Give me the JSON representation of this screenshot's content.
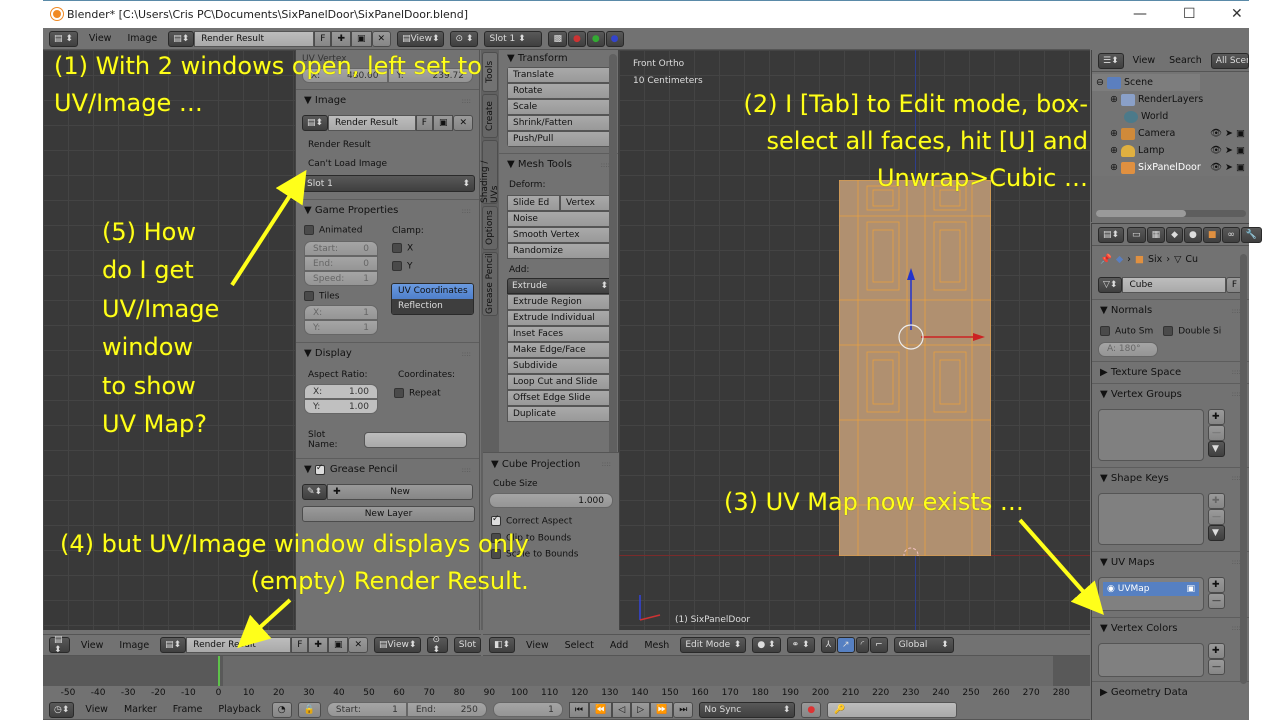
{
  "window": {
    "title": "Blender* [C:\\Users\\Cris PC\\Documents\\SixPanelDoor\\SixPanelDoor.blend]",
    "controls": {
      "minimize": "—",
      "maximize": "☐",
      "close": "✕"
    }
  },
  "image_editor_top_header": {
    "menus": [
      "View",
      "Image"
    ],
    "image_name": "Render Result",
    "fake_user": "F",
    "view_label": "View",
    "slot": "Slot 1"
  },
  "uv_image_properties": {
    "uv_vertex_header": "UV Vertex",
    "uv_x_label": "X:",
    "uv_x": "480.00",
    "uv_y_label": "Y:",
    "uv_y": "239.72",
    "image_section": "Image",
    "image_name": "Render Result",
    "fake_user": "F",
    "source_label": "Render Result",
    "status": "Can't Load Image",
    "slot": "Slot 1",
    "game_properties": "Game Properties",
    "animated": "Animated",
    "clamp": "Clamp:",
    "start_label": "Start:",
    "start": "0",
    "end_label": "End:",
    "end": "0",
    "speed_label": "Speed:",
    "speed": "1",
    "clamp_x": "X",
    "clamp_y": "Y",
    "mapping_options": [
      "UV Coordinates",
      "Reflection"
    ],
    "mapping_selected": "UV Coordinates",
    "tiles": "Tiles",
    "tiles_x_label": "X:",
    "tiles_x": "1",
    "tiles_y_label": "Y:",
    "tiles_y": "1",
    "display_section": "Display",
    "aspect_ratio": "Aspect Ratio:",
    "coordinates": "Coordinates:",
    "aspect_x_label": "X:",
    "aspect_x": "1.00",
    "aspect_y_label": "Y:",
    "aspect_y": "1.00",
    "repeat": "Repeat",
    "slot_name_label": "Slot Name:",
    "slot_name_value": "",
    "grease_pencil_section": "Grease Pencil",
    "new_button": "New",
    "new_layer_button": "New Layer"
  },
  "tool_shelf": {
    "tabs": [
      "Tools",
      "Create",
      "Shading / UVs",
      "Options",
      "Grease Pencil"
    ],
    "transform_header": "Transform",
    "transform_buttons": [
      "Translate",
      "Rotate",
      "Scale",
      "Shrink/Fatten",
      "Push/Pull"
    ],
    "mesh_tools_header": "Mesh Tools",
    "deform_label": "Deform:",
    "deform_row": [
      "Slide Ed",
      "Vertex"
    ],
    "deform_buttons": [
      "Noise",
      "Smooth Vertex",
      "Randomize"
    ],
    "add_label": "Add:",
    "extrude_dropdown": "Extrude",
    "add_buttons": [
      "Extrude Region",
      "Extrude Individual",
      "Inset Faces",
      "Make Edge/Face",
      "Subdivide",
      "Loop Cut and Slide",
      "Offset Edge Slide",
      "Duplicate"
    ],
    "cube_projection_header": "Cube Projection",
    "cube_size_label": "Cube Size",
    "cube_size": "1.000",
    "correct_aspect": "Correct Aspect",
    "clip_to_bounds": "Clip to Bounds",
    "scale_to_bounds": "Scale to Bounds"
  },
  "viewport": {
    "view_name": "Front Ortho",
    "scale": "10 Centimeters",
    "object_label": "(1) SixPanelDoor"
  },
  "viewport_header": {
    "menus": [
      "View",
      "Select",
      "Add",
      "Mesh"
    ],
    "mode": "Edit Mode",
    "orientation": "Global"
  },
  "outliner": {
    "menus": [
      "View",
      "Search"
    ],
    "filter": "All Scenes",
    "items": [
      {
        "label": "Scene",
        "icon": "scene-icon",
        "level": 0
      },
      {
        "label": "RenderLayers",
        "icon": "render-layers-icon",
        "level": 1
      },
      {
        "label": "World",
        "icon": "world-icon",
        "level": 1
      },
      {
        "label": "Camera",
        "icon": "camera-icon",
        "level": 1
      },
      {
        "label": "Lamp",
        "icon": "lamp-icon",
        "level": 1
      },
      {
        "label": "SixPanelDoor",
        "icon": "mesh-icon",
        "level": 1
      }
    ]
  },
  "properties": {
    "breadcrumb": [
      "Six",
      "Cu"
    ],
    "mesh_name": "Cube",
    "fake_user": "F",
    "normals": "Normals",
    "auto_smooth": "Auto Sm",
    "double_sided": "Double Si",
    "angle": "A: 180°",
    "texture_space": "Texture Space",
    "vertex_groups": "Vertex Groups",
    "shape_keys": "Shape Keys",
    "uv_maps": "UV Maps",
    "uv_map_item": "UVMap",
    "vertex_colors": "Vertex Colors",
    "geometry_data": "Geometry Data"
  },
  "image_editor_bottom_header": {
    "menus": [
      "View",
      "Image"
    ],
    "image_name": "Render Result",
    "fake_user": "F",
    "view_label": "View",
    "slot": "Slot"
  },
  "timeline": {
    "ticks": [
      "-50",
      "-40",
      "-30",
      "-20",
      "-10",
      "0",
      "10",
      "20",
      "30",
      "40",
      "50",
      "60",
      "70",
      "80",
      "90",
      "100",
      "110",
      "120",
      "130",
      "140",
      "150",
      "160",
      "170",
      "180",
      "190",
      "200",
      "210",
      "220",
      "230",
      "240",
      "250",
      "260",
      "270",
      "280"
    ],
    "current_frame_marker": 0,
    "menus": [
      "View",
      "Marker",
      "Frame",
      "Playback"
    ],
    "start_label": "Start:",
    "start": "1",
    "end_label": "End:",
    "end": "250",
    "current": "1",
    "sync": "No Sync"
  },
  "annotations": {
    "a1": [
      "(1) With 2 windows open, left set to",
      "UV/Image …"
    ],
    "a2": [
      "(2) I [Tab] to Edit mode, box-",
      "select all faces, hit [U] and",
      "Unwrap>Cubic …"
    ],
    "a3": "(3) UV Map now exists …",
    "a4": [
      "(4) but UV/Image window displays only",
      "(empty) Render Result."
    ],
    "a5": [
      "(5) How",
      "do I get",
      "UV/Image",
      "window",
      "to show",
      "UV Map?"
    ],
    "color": "#ffff1a"
  }
}
